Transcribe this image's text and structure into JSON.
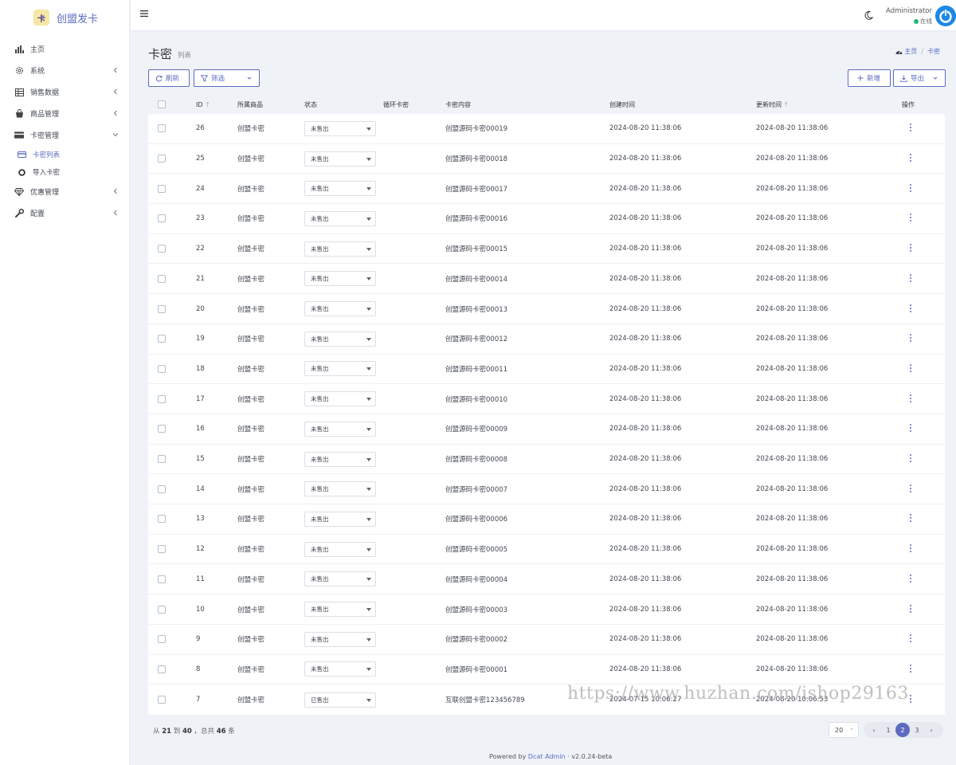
{
  "brand": {
    "logo_text": "卡",
    "name": "创盟发卡"
  },
  "sidebar": {
    "items": [
      {
        "label": "主页",
        "icon": "bar-chart-icon"
      },
      {
        "label": "系统",
        "icon": "gear-icon"
      },
      {
        "label": "销售数据",
        "icon": "table-icon"
      },
      {
        "label": "商品管理",
        "icon": "shopping-bag-icon"
      },
      {
        "label": "卡密管理",
        "icon": "credit-card-icon"
      },
      {
        "label": "卡密列表",
        "icon": "card-icon"
      },
      {
        "label": "导入卡密",
        "icon": "circle-icon"
      },
      {
        "label": "优惠管理",
        "icon": "diamond-icon"
      },
      {
        "label": "配置",
        "icon": "wrench-icon"
      }
    ]
  },
  "topbar": {
    "user_name": "Administrator",
    "user_status": "在线"
  },
  "header": {
    "title": "卡密",
    "subtitle": "列表",
    "breadcrumb_home": "主页",
    "breadcrumb_current": "卡密"
  },
  "toolbar": {
    "refresh": "刷新",
    "filter": "筛选",
    "add": "新增",
    "export": "导出"
  },
  "table": {
    "columns": [
      "ID",
      "所属商品",
      "状态",
      "循环卡密",
      "卡密内容",
      "创建时间",
      "更新时间",
      "操作"
    ],
    "rows": [
      {
        "id": "26",
        "product": "创盟卡密",
        "status": "未售出",
        "content": "创盟源码卡密00019",
        "created": "2024-08-20 11:38:06",
        "updated": "2024-08-20 11:38:06"
      },
      {
        "id": "25",
        "product": "创盟卡密",
        "status": "未售出",
        "content": "创盟源码卡密00018",
        "created": "2024-08-20 11:38:06",
        "updated": "2024-08-20 11:38:06"
      },
      {
        "id": "24",
        "product": "创盟卡密",
        "status": "未售出",
        "content": "创盟源码卡密00017",
        "created": "2024-08-20 11:38:06",
        "updated": "2024-08-20 11:38:06"
      },
      {
        "id": "23",
        "product": "创盟卡密",
        "status": "未售出",
        "content": "创盟源码卡密00016",
        "created": "2024-08-20 11:38:06",
        "updated": "2024-08-20 11:38:06"
      },
      {
        "id": "22",
        "product": "创盟卡密",
        "status": "未售出",
        "content": "创盟源码卡密00015",
        "created": "2024-08-20 11:38:06",
        "updated": "2024-08-20 11:38:06"
      },
      {
        "id": "21",
        "product": "创盟卡密",
        "status": "未售出",
        "content": "创盟源码卡密00014",
        "created": "2024-08-20 11:38:06",
        "updated": "2024-08-20 11:38:06"
      },
      {
        "id": "20",
        "product": "创盟卡密",
        "status": "未售出",
        "content": "创盟源码卡密00013",
        "created": "2024-08-20 11:38:06",
        "updated": "2024-08-20 11:38:06"
      },
      {
        "id": "19",
        "product": "创盟卡密",
        "status": "未售出",
        "content": "创盟源码卡密00012",
        "created": "2024-08-20 11:38:06",
        "updated": "2024-08-20 11:38:06"
      },
      {
        "id": "18",
        "product": "创盟卡密",
        "status": "未售出",
        "content": "创盟源码卡密00011",
        "created": "2024-08-20 11:38:06",
        "updated": "2024-08-20 11:38:06"
      },
      {
        "id": "17",
        "product": "创盟卡密",
        "status": "未售出",
        "content": "创盟源码卡密00010",
        "created": "2024-08-20 11:38:06",
        "updated": "2024-08-20 11:38:06"
      },
      {
        "id": "16",
        "product": "创盟卡密",
        "status": "未售出",
        "content": "创盟源码卡密00009",
        "created": "2024-08-20 11:38:06",
        "updated": "2024-08-20 11:38:06"
      },
      {
        "id": "15",
        "product": "创盟卡密",
        "status": "未售出",
        "content": "创盟源码卡密00008",
        "created": "2024-08-20 11:38:06",
        "updated": "2024-08-20 11:38:06"
      },
      {
        "id": "14",
        "product": "创盟卡密",
        "status": "未售出",
        "content": "创盟源码卡密00007",
        "created": "2024-08-20 11:38:06",
        "updated": "2024-08-20 11:38:06"
      },
      {
        "id": "13",
        "product": "创盟卡密",
        "status": "未售出",
        "content": "创盟源码卡密00006",
        "created": "2024-08-20 11:38:06",
        "updated": "2024-08-20 11:38:06"
      },
      {
        "id": "12",
        "product": "创盟卡密",
        "status": "未售出",
        "content": "创盟源码卡密00005",
        "created": "2024-08-20 11:38:06",
        "updated": "2024-08-20 11:38:06"
      },
      {
        "id": "11",
        "product": "创盟卡密",
        "status": "未售出",
        "content": "创盟源码卡密00004",
        "created": "2024-08-20 11:38:06",
        "updated": "2024-08-20 11:38:06"
      },
      {
        "id": "10",
        "product": "创盟卡密",
        "status": "未售出",
        "content": "创盟源码卡密00003",
        "created": "2024-08-20 11:38:06",
        "updated": "2024-08-20 11:38:06"
      },
      {
        "id": "9",
        "product": "创盟卡密",
        "status": "未售出",
        "content": "创盟源码卡密00002",
        "created": "2024-08-20 11:38:06",
        "updated": "2024-08-20 11:38:06"
      },
      {
        "id": "8",
        "product": "创盟卡密",
        "status": "未售出",
        "content": "创盟源码卡密00001",
        "created": "2024-08-20 11:38:06",
        "updated": "2024-08-20 11:38:06"
      },
      {
        "id": "7",
        "product": "创盟卡密",
        "status": "已售出",
        "content": "互联创盟卡密123456789",
        "created": "2024-07-15 10:06:27",
        "updated": "2024-08-20 10:06:53"
      }
    ]
  },
  "pagination": {
    "from_label": "从",
    "from": "21",
    "to_label": "到",
    "to": "40",
    "total_label": "，总共",
    "total": "46",
    "unit": "条",
    "per_page": "20",
    "pages": [
      "1",
      "2",
      "3"
    ],
    "current": "2"
  },
  "footer": {
    "powered_by": "Powered by",
    "link": "Dcat Admin",
    "sep": "·",
    "version": "v2.0.24-beta"
  },
  "watermark": "https://www.huzhan.com/ishop29163",
  "colors": {
    "accent": "#5c6bc0",
    "online": "#21b978",
    "avatar": "#1e88e5"
  }
}
